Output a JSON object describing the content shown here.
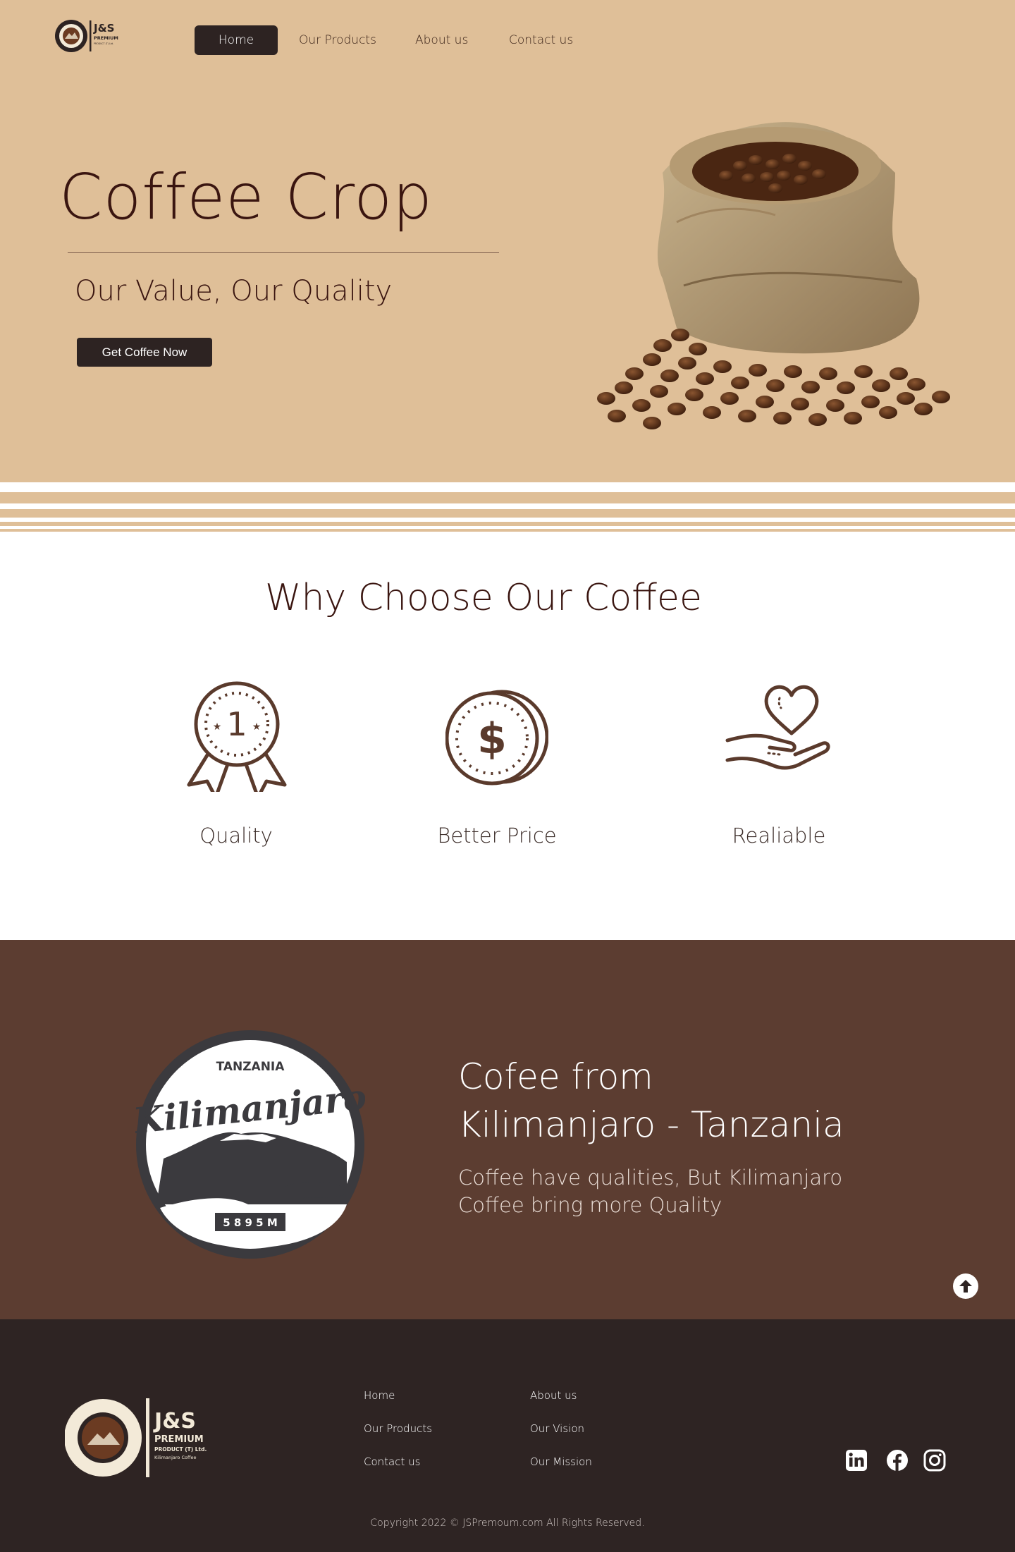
{
  "brand": {
    "logo_text": "J&S",
    "logo_sub1": "PREMIUM",
    "logo_sub2": "PRODUCT (T) Ltd.",
    "logo_sub3": "Kilimanjaro Coffee"
  },
  "nav": {
    "items": [
      {
        "label": "Home",
        "active": true
      },
      {
        "label": "Our Products",
        "active": false
      },
      {
        "label": "About us",
        "active": false
      },
      {
        "label": "Contact us",
        "active": false
      }
    ]
  },
  "hero": {
    "title": "Coffee Crop",
    "subtitle": "Our Value, Our Quality",
    "cta_label": "Get Coffee Now"
  },
  "why": {
    "title": "Why Choose Our Coffee",
    "features": [
      {
        "label": "Quality",
        "icon": "award-ribbon-icon",
        "badge_number": "1"
      },
      {
        "label": "Better Price",
        "icon": "dollar-coins-icon",
        "symbol": "$"
      },
      {
        "label": "Realiable",
        "icon": "hand-heart-icon"
      }
    ]
  },
  "kilimanjaro": {
    "badge_top": "TANZANIA",
    "badge_name": "Kilimanjaro",
    "badge_height": "5 8 9 5 M",
    "title_line1": "Cofee from",
    "title_line2": "Kilimanjaro - Tanzania",
    "text": "Coffee have qualities, But Kilimanjaro Coffee bring more Quality"
  },
  "footer": {
    "col1": [
      "Home",
      "Our Products",
      "Contact us"
    ],
    "col2": [
      "About us",
      "Our Vision",
      "Our Mission"
    ],
    "social": [
      "linkedin-icon",
      "facebook-icon",
      "instagram-icon"
    ],
    "copyright": "Copyright 2022 © JSPremoum.com  All Rights Reserved."
  },
  "colors": {
    "tan": "#dfbf98",
    "dark": "#2d2322",
    "brown": "#5c3d31",
    "heading": "#3a1510"
  }
}
